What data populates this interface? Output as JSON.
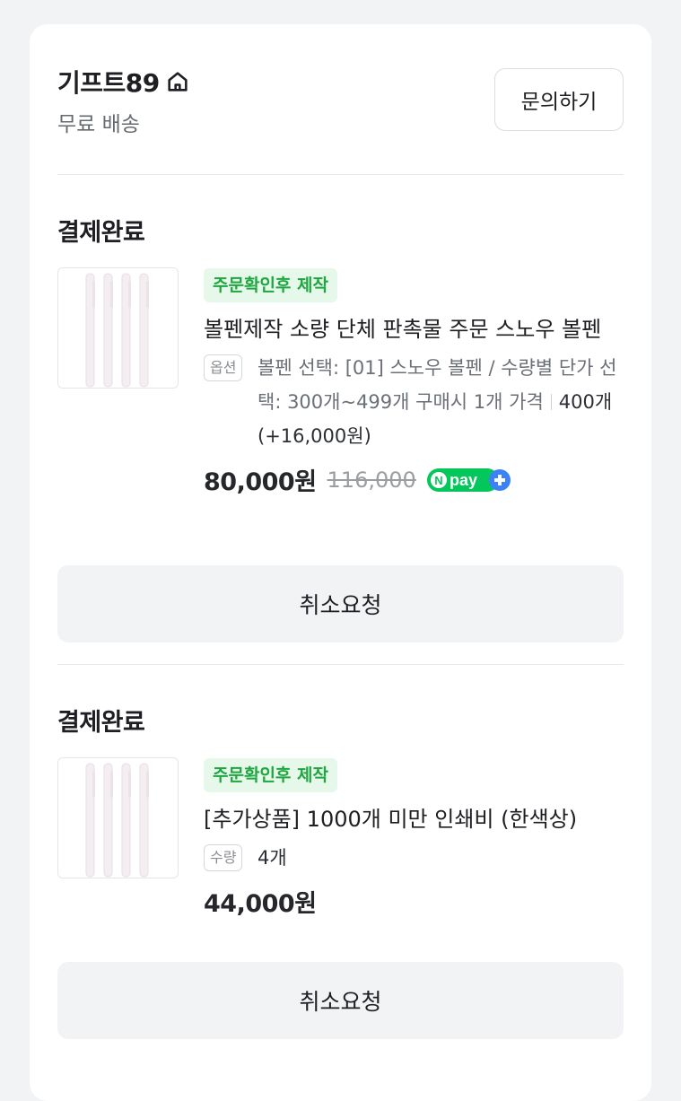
{
  "seller": {
    "name": "기프트89",
    "shipping": "무료 배송",
    "inquiry_label": "문의하기"
  },
  "orders": [
    {
      "status": "결제완료",
      "badge": "주문확인후 제작",
      "title": "볼펜제작 소량 단체 판촉물 주문 스노우 볼펜",
      "option_tag": "옵션",
      "option_text": "볼펜 선택: [01] 스노우 볼펜 / 수량별 단가 선택: 300개~499개 구매시 1개 가격",
      "quantity_text": "400개 (+16,000원)",
      "price": "80,000원",
      "original_price": "116,000",
      "pay_badge": "N pay",
      "cancel_label": "취소요청"
    },
    {
      "status": "결제완료",
      "badge": "주문확인후 제작",
      "title": "[추가상품] 1000개 미만 인쇄비 (한색상)",
      "option_tag": "수량",
      "quantity_text": "4개",
      "price": "44,000원",
      "cancel_label": "취소요청"
    }
  ],
  "colors": {
    "badge_green": "#1fa640",
    "npay_green": "#03c75a",
    "npay_plus_blue": "#3b82f6"
  }
}
